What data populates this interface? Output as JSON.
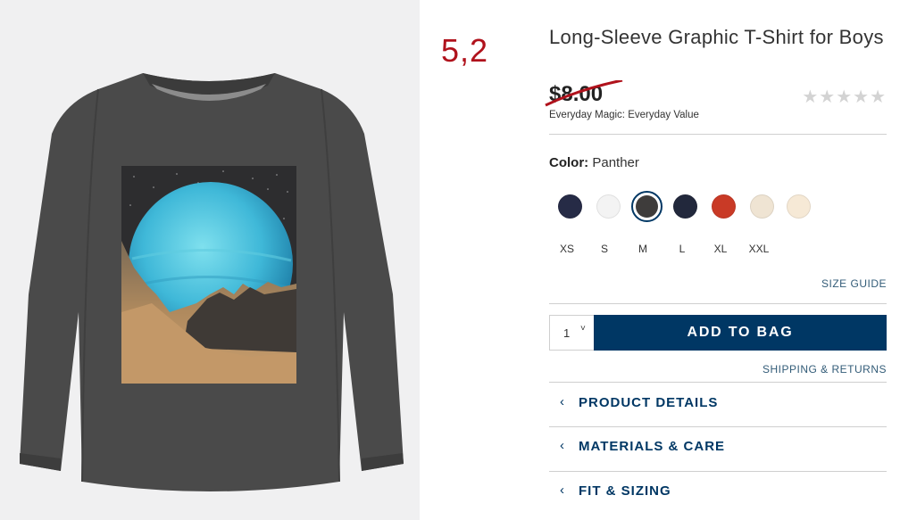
{
  "sale_price": "5,2",
  "product": {
    "title": "Long-Sleeve Graphic T-Shirt for Boys",
    "original_price": "$8.00",
    "tagline": "Everyday Magic: Everyday Value",
    "rating_stars": "★★★★★"
  },
  "color": {
    "label": "Color:",
    "value": "Panther",
    "swatches": [
      {
        "hex": "#262b46"
      },
      {
        "hex": "#f3f3f3"
      },
      {
        "hex": "#3e3c3b",
        "selected": true
      },
      {
        "hex": "#22283c"
      },
      {
        "hex": "#c93a26"
      },
      {
        "hex": "#efe4d3"
      },
      {
        "hex": "#f6e9d6"
      }
    ]
  },
  "sizes": [
    "XS",
    "S",
    "M",
    "L",
    "XL",
    "XXL"
  ],
  "size_guide": "SIZE GUIDE",
  "quantity": {
    "value": "1",
    "caret": "˅"
  },
  "add_to_bag": "ADD TO BAG",
  "shipping_returns": "SHIPPING & RETURNS",
  "accordions": [
    {
      "label": "PRODUCT DETAILS",
      "chevron": "‹"
    },
    {
      "label": "MATERIALS & CARE",
      "chevron": "‹"
    },
    {
      "label": "FIT & SIZING",
      "chevron": "‹"
    }
  ],
  "colors": {
    "navy": "#003764",
    "sale_red": "#b0121c",
    "link_blue": "#335c78"
  }
}
